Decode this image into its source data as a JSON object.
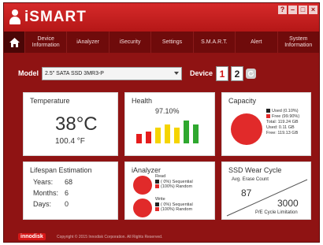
{
  "app": {
    "name": "iSMART",
    "window_buttons": [
      "?",
      "–",
      "□",
      "×"
    ]
  },
  "nav": {
    "items": [
      {
        "label": "Device\nInformation"
      },
      {
        "label": "iAnalyzer"
      },
      {
        "label": "iSecurity"
      },
      {
        "label": "Settings"
      },
      {
        "label": "S.M.A.R.T."
      },
      {
        "label": "Alert"
      },
      {
        "label": "System\nInformation"
      }
    ]
  },
  "model": {
    "label": "Model",
    "value": "2.5\" SATA SSD 3MR3-P"
  },
  "device": {
    "label": "Device",
    "buttons": [
      "1",
      "2"
    ]
  },
  "temperature": {
    "title": "Temperature",
    "celsius": "38°C",
    "fahrenheit": "100.4  °F"
  },
  "health": {
    "title": "Health",
    "percent": "97.10%",
    "bar_colors": [
      "#e51c1c",
      "#e51c1c",
      "#f5d400",
      "#f5d400",
      "#f5d400",
      "#2fa82f",
      "#2fa82f"
    ],
    "bar_levels": [
      0.35,
      0.45,
      0.6,
      0.72,
      0.6,
      0.85,
      0.7
    ]
  },
  "capacity": {
    "title": "Capacity",
    "used_label": "Used (0.10%)",
    "free_label": "Free (99.90%)",
    "total": "Total: 119.24 GB",
    "used": "Used: 0.11 GB",
    "free": "Free: 119.13 GB",
    "used_color": "#222222",
    "free_color": "#e12a2a",
    "used_fraction": 0.001
  },
  "lifespan": {
    "title": "Lifespan Estimation",
    "rows": [
      {
        "label": "Years:",
        "value": "68"
      },
      {
        "label": "Months:",
        "value": "6"
      },
      {
        "label": "Days:",
        "value": "0"
      }
    ]
  },
  "ianalyzer": {
    "title": "iAnalyzer",
    "read_label": "Read",
    "read_seq": "(  0%) Sequential",
    "read_rand": "(100%) Random",
    "write_label": "Write",
    "write_seq": "(  0%) Sequential",
    "write_rand": "(100%) Random"
  },
  "wear": {
    "title": "SSD Wear Cycle",
    "avg_label": "Avg. Erase Count",
    "avg_value": "87",
    "limit_value": "3000",
    "limit_label": "P/E Cycle Limitation"
  },
  "footer": {
    "brand": "innodisk",
    "copyright": "Copyright © 2015 Innodisk Corporation. All Rights Reserved."
  },
  "colors": {
    "accent": "#d01616",
    "background": "#8f1313",
    "nav": "#6f0b0b"
  }
}
